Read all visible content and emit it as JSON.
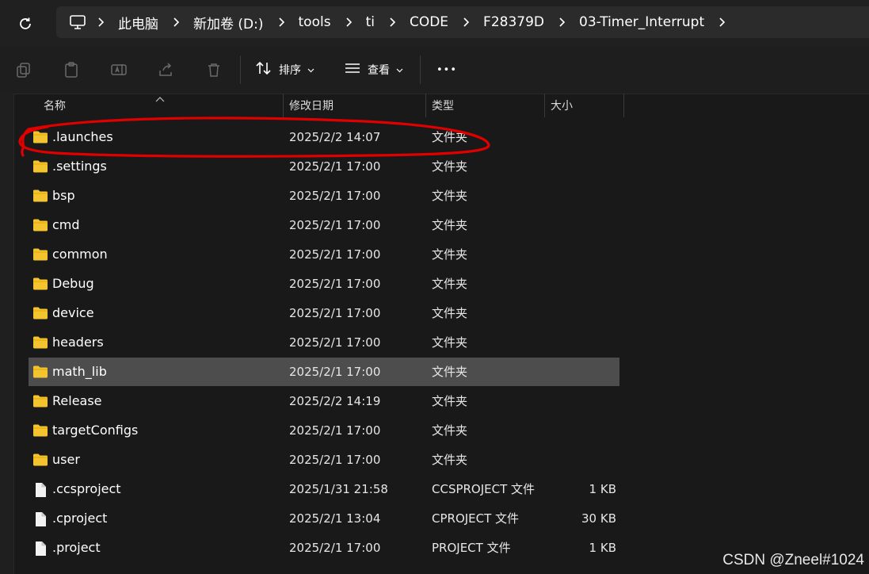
{
  "address": {
    "crumbs": [
      "此电脑",
      "新加卷 (D:)",
      "tools",
      "ti",
      "CODE",
      "F28379D",
      "03-Timer_Interrupt"
    ]
  },
  "toolbar": {
    "sort_label": "排序",
    "view_label": "查看",
    "more_label": "•••"
  },
  "columns": {
    "name": "名称",
    "date": "修改日期",
    "type": "类型",
    "size": "大小"
  },
  "files": [
    {
      "name": ".launches",
      "date": "2025/2/2 14:07",
      "type": "文件夹",
      "size": "",
      "kind": "folder-icon"
    },
    {
      "name": ".settings",
      "date": "2025/2/1 17:00",
      "type": "文件夹",
      "size": "",
      "kind": "folder-icon"
    },
    {
      "name": "bsp",
      "date": "2025/2/1 17:00",
      "type": "文件夹",
      "size": "",
      "kind": "folder-icon"
    },
    {
      "name": "cmd",
      "date": "2025/2/1 17:00",
      "type": "文件夹",
      "size": "",
      "kind": "folder-icon"
    },
    {
      "name": "common",
      "date": "2025/2/1 17:00",
      "type": "文件夹",
      "size": "",
      "kind": "folder-icon"
    },
    {
      "name": "Debug",
      "date": "2025/2/1 17:00",
      "type": "文件夹",
      "size": "",
      "kind": "folder-icon"
    },
    {
      "name": "device",
      "date": "2025/2/1 17:00",
      "type": "文件夹",
      "size": "",
      "kind": "folder-icon"
    },
    {
      "name": "headers",
      "date": "2025/2/1 17:00",
      "type": "文件夹",
      "size": "",
      "kind": "folder-icon"
    },
    {
      "name": "math_lib",
      "date": "2025/2/1 17:00",
      "type": "文件夹",
      "size": "",
      "kind": "folder-icon"
    },
    {
      "name": "Release",
      "date": "2025/2/2 14:19",
      "type": "文件夹",
      "size": "",
      "kind": "folder-icon"
    },
    {
      "name": "targetConfigs",
      "date": "2025/2/1 17:00",
      "type": "文件夹",
      "size": "",
      "kind": "folder-icon"
    },
    {
      "name": "user",
      "date": "2025/2/1 17:00",
      "type": "文件夹",
      "size": "",
      "kind": "folder-icon"
    },
    {
      "name": ".ccsproject",
      "date": "2025/1/31 21:58",
      "type": "CCSPROJECT 文件",
      "size": "1 KB",
      "kind": "file-icon"
    },
    {
      "name": ".cproject",
      "date": "2025/2/1 13:04",
      "type": "CPROJECT 文件",
      "size": "30 KB",
      "kind": "file-icon"
    },
    {
      "name": ".project",
      "date": "2025/2/1 17:00",
      "type": "PROJECT 文件",
      "size": "1 KB",
      "kind": "file-icon"
    }
  ],
  "selected_file": "math_lib",
  "annotation_color": "#e00000",
  "folder_color": "#f4c430",
  "watermark": "CSDN @Zneel#1024"
}
